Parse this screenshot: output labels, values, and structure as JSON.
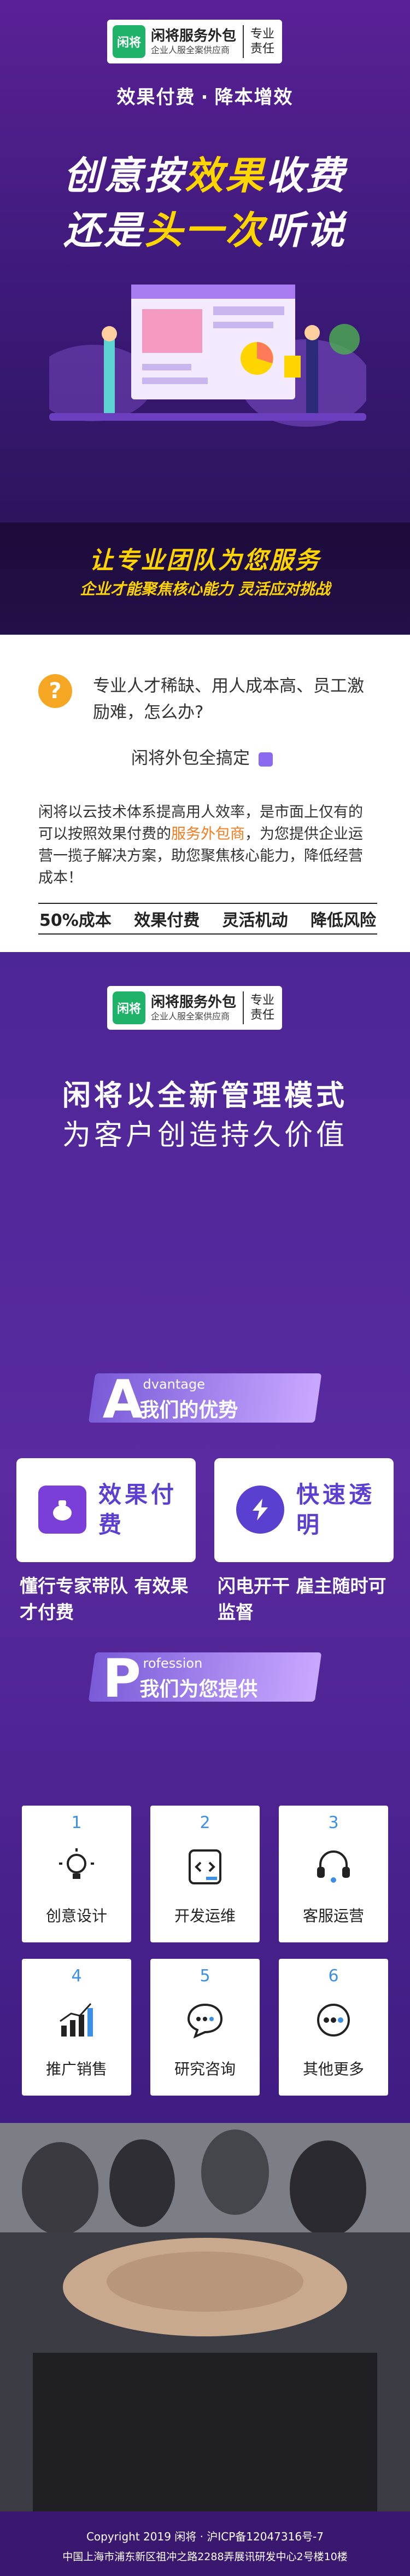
{
  "brand": {
    "mark": "闲将",
    "name": "闲将服务外包",
    "tagline": "企业人服全案供应商",
    "side_line1": "专业",
    "side_line2": "责任"
  },
  "hero": {
    "tag_left": "效果付费",
    "tag_sep": "·",
    "tag_right": "降本增效",
    "title1_a": "创意按",
    "title1_b": "效果",
    "title1_c": "收费",
    "title2_a": "还是",
    "title2_b": "头一次",
    "title2_c": "听说"
  },
  "banner": {
    "line1": "让专业团队为您服务",
    "line2": "企业才能聚焦核心能力 灵活应对挑战"
  },
  "intro": {
    "question": "专业人才稀缺、用人成本高、员工激励难，怎么办?",
    "answer": "闲将外包全搞定",
    "para_a": "闲将以云技术体系提高用人效率，是市面上仅有的可以按照效果付费的",
    "para_hl": "服务外包商",
    "para_b": "，为您提供企业运营一揽子解决方案，助您聚焦核心能力，降低经营成本！",
    "pills": [
      "50%成本",
      "效果付费",
      "灵活机动",
      "降低风险"
    ]
  },
  "mgmt": {
    "line1": "闲将以全新管理模式",
    "line2": "为客户创造持久价值"
  },
  "advantage": {
    "big_letter": "A",
    "en": "dvantage",
    "title": "我们的优势",
    "cards": [
      {
        "icon": "money-bag-icon",
        "title": "效果付费",
        "desc": "懂行专家带队 有效果才付费"
      },
      {
        "icon": "lightning-icon",
        "title": "快速透明",
        "desc": "闪电开干 雇主随时可监督"
      }
    ]
  },
  "profession": {
    "big_letter": "P",
    "en": "rofession",
    "title": "我们为您提供",
    "services": [
      {
        "num": "1",
        "label": "创意设计",
        "icon": "lightbulb-icon"
      },
      {
        "num": "2",
        "label": "开发运维",
        "icon": "code-icon"
      },
      {
        "num": "3",
        "label": "客服运营",
        "icon": "headset-icon"
      },
      {
        "num": "4",
        "label": "推广销售",
        "icon": "bar-chart-icon"
      },
      {
        "num": "5",
        "label": "研究咨询",
        "icon": "chat-icon"
      },
      {
        "num": "6",
        "label": "其他更多",
        "icon": "more-icon"
      }
    ]
  },
  "footer": {
    "copyright": "Copyright 2019 闲将 · 沪ICP备12047316号-7",
    "address": "中国上海市浦东新区祖冲之路2288弄展讯研发中心2号楼10楼"
  },
  "colors": {
    "accent": "#ffd500",
    "purple": "#5a2aa0",
    "orange": "#f27c1f",
    "brand_green": "#1fb36a"
  }
}
